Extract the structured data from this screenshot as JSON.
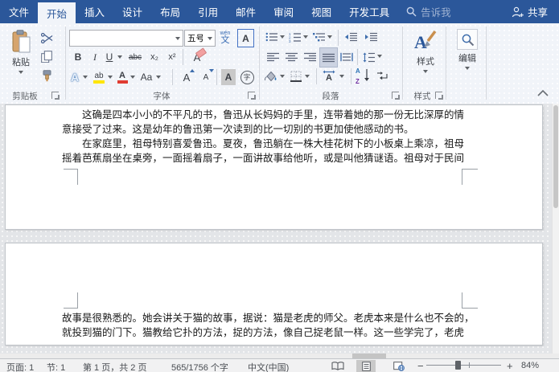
{
  "titlebar": {
    "tabs": [
      "文件",
      "开始",
      "插入",
      "设计",
      "布局",
      "引用",
      "邮件",
      "审阅",
      "视图",
      "开发工具"
    ],
    "active_tab": "开始",
    "tell_me": "告诉我",
    "share": "共享"
  },
  "ribbon": {
    "clipboard": {
      "group_label": "剪贴板",
      "paste_label": "粘贴"
    },
    "font": {
      "group_label": "字体",
      "font_name": "",
      "font_size": "五号",
      "phonetic_pinyin": "wén",
      "phonetic_char": "文",
      "char_border": "A",
      "bold": "B",
      "italic": "I",
      "underline": "U",
      "strikethrough": "abc",
      "subscript": "x₂",
      "superscript": "x²",
      "clear_format": "A",
      "text_effects": "A",
      "highlight": "ab",
      "font_color": "A",
      "change_case": "Aa",
      "grow_font": "A",
      "shrink_font": "A",
      "char_shading": "A",
      "enclose_char": "字"
    },
    "paragraph": {
      "group_label": "段落",
      "sort_a": "A",
      "sort_z": "Z",
      "char_scale": "A"
    },
    "styles": {
      "group_label": "样式",
      "button_label": "样式"
    },
    "editing": {
      "button_label": "编辑"
    }
  },
  "document": {
    "page1_lines": [
      "这确是四本小小的不平凡的书，鲁迅从长妈妈的手里，连带着她的那一份无比深厚的情",
      "意接受了过来。这是幼年的鲁迅第一次读到的比一切别的书更加使他感动的书。",
      "在家庭里，祖母特别喜爱鲁迅。夏夜，鲁迅躺在一株大桂花树下的小板桌上乘凉，祖母",
      "摇着芭蕉扇坐在桌旁，一面摇着扇子，一面讲故事给他听，或是叫他猜谜语。祖母对于民间"
    ],
    "page2_lines": [
      "故事是很熟悉的。她会讲关于猫的故事，据说：猫是老虎的师父。老虎本来是什么也不会的，",
      "就投到猫的门下。猫教给它扑的方法，捉的方法，像自己捉老鼠一样。这一些学完了，老虎"
    ]
  },
  "statusbar": {
    "page": "页面: 1",
    "section": "节: 1",
    "page_of_pages": "第 1 页，共 2 页",
    "word_count": "565/1756 个字",
    "language": "中文(中国)",
    "zoom_out": "−",
    "zoom_in": "+",
    "zoom_level": "84%"
  },
  "colors": {
    "titlebar_blue": "#2b579a",
    "highlight_yellow": "#ffe600",
    "font_color_red": "#e03c32",
    "selected_gray": "#ccd3e2"
  }
}
